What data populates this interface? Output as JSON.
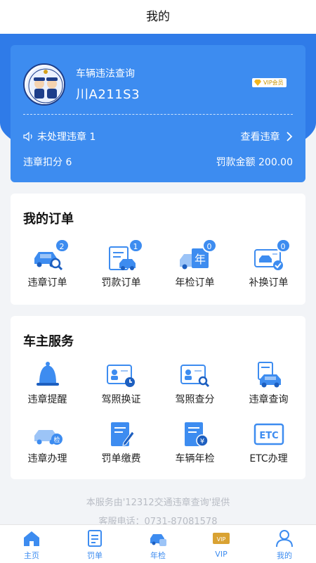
{
  "header": {
    "title": "我的"
  },
  "card": {
    "app_name": "车辆违法查询",
    "plate": "川A211S3",
    "vip_label": "VIP会员",
    "unhandled_label": "未处理违章 1",
    "view_label": "查看违章",
    "points_label": "违章扣分 6",
    "fine_label": "罚款金额 200.00"
  },
  "orders": {
    "title": "我的订单",
    "items": [
      {
        "label": "违章订单",
        "badge": "2",
        "icon": "car-search-icon"
      },
      {
        "label": "罚款订单",
        "badge": "1",
        "icon": "fine-car-icon"
      },
      {
        "label": "年检订单",
        "badge": "0",
        "icon": "annual-check-icon"
      },
      {
        "label": "补换订单",
        "badge": "0",
        "icon": "card-replace-icon"
      }
    ]
  },
  "services": {
    "title": "车主服务",
    "items": [
      {
        "label": "违章提醒",
        "icon": "bell-icon"
      },
      {
        "label": "驾照换证",
        "icon": "license-renew-icon"
      },
      {
        "label": "驾照查分",
        "icon": "license-score-icon"
      },
      {
        "label": "违章查询",
        "icon": "car-query-icon"
      },
      {
        "label": "违章办理",
        "icon": "car-handle-icon"
      },
      {
        "label": "罚单缴费",
        "icon": "ticket-pay-icon"
      },
      {
        "label": "车辆年检",
        "icon": "vehicle-inspection-icon"
      },
      {
        "label": "ETC办理",
        "icon": "etc-icon",
        "icon_text": "ETC"
      }
    ]
  },
  "footer": {
    "provider": "本服务由'12312交通违章查询'提供",
    "hotline": "客服电话：0731-87081578"
  },
  "tabs": [
    {
      "label": "主页",
      "icon": "home-icon"
    },
    {
      "label": "罚单",
      "icon": "ticket-icon"
    },
    {
      "label": "年检",
      "icon": "car-check-icon"
    },
    {
      "label": "VIP",
      "icon": "vip-icon",
      "icon_text": "VIP"
    },
    {
      "label": "我的",
      "icon": "user-icon"
    }
  ],
  "colors": {
    "accent": "#3d8cf0",
    "band": "#2f7be8",
    "icon_light": "#9cc4f7"
  }
}
